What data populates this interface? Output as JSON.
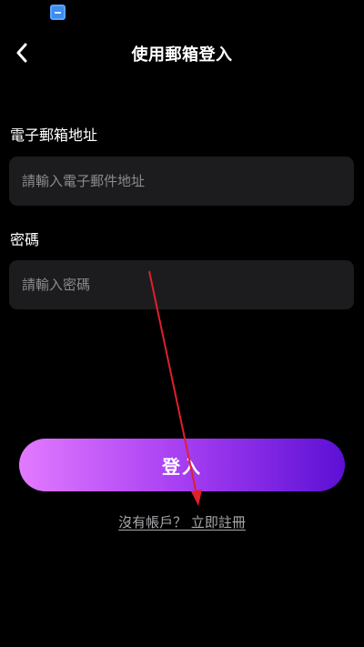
{
  "status_bar": {
    "app_icon": "app-notification-icon"
  },
  "header": {
    "back_icon": "chevron-left-icon",
    "title": "使用郵箱登入"
  },
  "form": {
    "email": {
      "label": "電子郵箱地址",
      "placeholder": "請輸入電子郵件地址",
      "value": ""
    },
    "password": {
      "label": "密碼",
      "placeholder": "請輸入密碼",
      "value": ""
    }
  },
  "actions": {
    "login_label": "登入",
    "register_label": "沒有帳戶？ 立即註冊"
  },
  "colors": {
    "background": "#000000",
    "field_background": "#1c1c1e",
    "button_gradient_start": "#e27aff",
    "button_gradient_end": "#5c10d4",
    "annotation_arrow": "#e0202a"
  }
}
